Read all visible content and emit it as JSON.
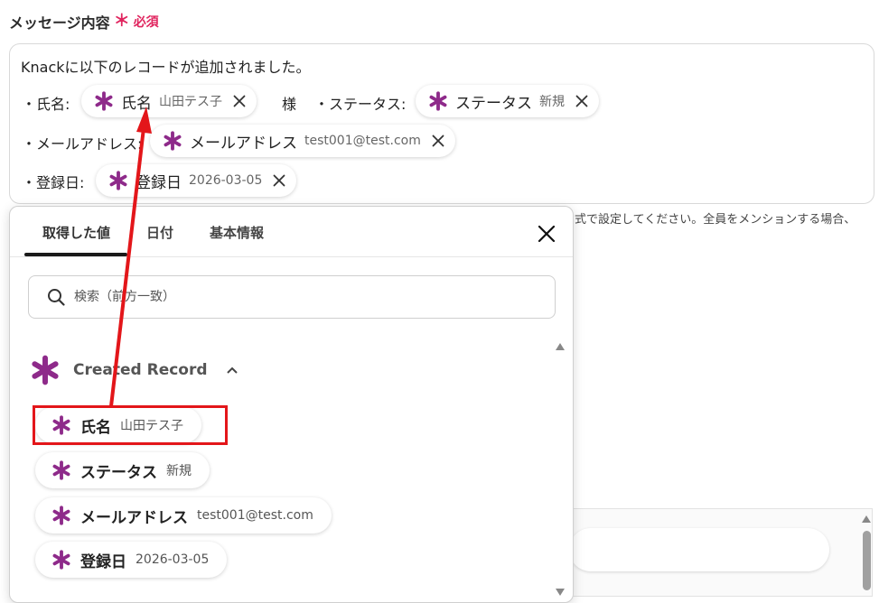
{
  "field": {
    "label": "メッセージ内容",
    "required_mark": "＊",
    "required_text": "必須"
  },
  "editor": {
    "line1": "Knackに以下のレコードが追加されました。",
    "name_prefix": "・氏名:",
    "sama": "様",
    "status_prefix": "・ステータス:",
    "email_prefix": "・メールアドレス:",
    "date_prefix": "・登録日:",
    "chips": {
      "name": {
        "label": "氏名",
        "value": "山田テス子"
      },
      "status": {
        "label": "ステータス",
        "value": "新規"
      },
      "email": {
        "label": "メールアドレス",
        "value": "test001@test.com"
      },
      "date": {
        "label": "登録日",
        "value": "2026-03-05"
      }
    }
  },
  "hint_text": "式で設定してください。全員をメンションする場合、",
  "popup": {
    "tabs": [
      {
        "label": "取得した値"
      },
      {
        "label": "日付"
      },
      {
        "label": "基本情報"
      }
    ],
    "active_tab": "取得した値",
    "search_placeholder": "検索（前方一致）",
    "group_title": "Created Record",
    "items": [
      {
        "label": "氏名",
        "value": "山田テス子"
      },
      {
        "label": "ステータス",
        "value": "新規"
      },
      {
        "label": "メールアドレス",
        "value": "test001@test.com"
      },
      {
        "label": "登録日",
        "value": "2026-03-05"
      }
    ]
  },
  "colors": {
    "brand_asterisk": "#8e2a8a",
    "required": "#e0245e",
    "annotation": "#e3161a"
  },
  "icons": {
    "asterisk": "knack-asterisk-icon",
    "remove": "close-icon",
    "search": "search-icon",
    "collapse": "chevron-up-icon"
  }
}
